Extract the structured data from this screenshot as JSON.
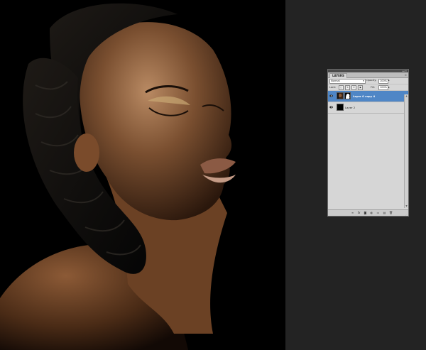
{
  "panel": {
    "tab_label": "LAYERS",
    "menu_icon": "panel-menu-icon",
    "collapse_icon": "collapse-icon",
    "close_icon": "close-icon"
  },
  "options": {
    "blend_mode": "Normal",
    "opacity_label": "Opacity:",
    "opacity_value": "100%",
    "lock_label": "Lock:",
    "fill_label": "Fill:",
    "fill_value": "100%"
  },
  "layers": [
    {
      "name": "Layer 0 copy 4",
      "selected": true,
      "visible": true,
      "has_mask": true
    },
    {
      "name": "Layer 2",
      "selected": false,
      "visible": true,
      "has_mask": false
    }
  ],
  "bottom_icons": [
    "link-layers-icon",
    "fx-icon",
    "add-mask-icon",
    "adjustment-layer-icon",
    "new-group-icon",
    "new-layer-icon",
    "trash-icon"
  ],
  "colors": {
    "selection": "#4f86c6",
    "panel_bg": "#d6d6d6",
    "workspace_bg": "#232323",
    "canvas_bg": "#000000"
  }
}
